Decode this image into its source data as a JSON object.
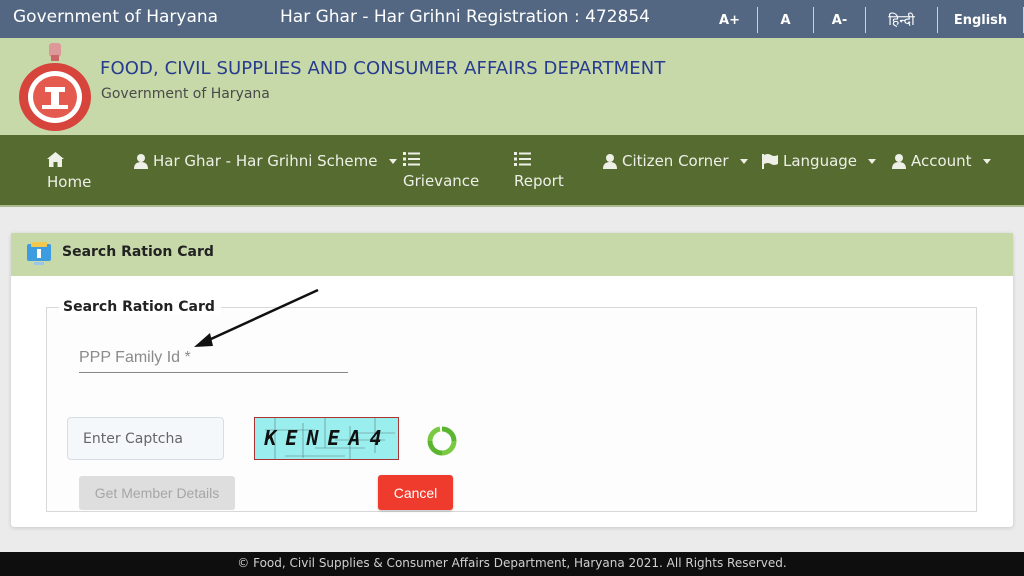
{
  "topbar": {
    "government": "Government of Haryana",
    "registration": "Har Ghar - Har Grihni Registration : 472854",
    "font_increase": "A+",
    "font_normal": "A",
    "font_decrease": "A-",
    "lang_hindi": "हिन्दी",
    "lang_english": "English"
  },
  "brand": {
    "department": "FOOD, CIVIL SUPPLIES AND CONSUMER AFFAIRS DEPARTMENT",
    "subtitle": "Government of Haryana",
    "emblem": "haryana-emblem-icon"
  },
  "nav": {
    "home": "Home",
    "scheme": "Har Ghar - Har Grihni Scheme",
    "grievance": "Grievance",
    "report": "Report",
    "citizen": "Citizen Corner",
    "language": "Language",
    "account": "Account"
  },
  "panel": {
    "title": "Search Ration Card",
    "legend": "Search Ration Card",
    "ppp_placeholder": "PPP Family Id *",
    "ppp_value": "",
    "captcha_placeholder": "Enter Captcha",
    "captcha_value": "",
    "captcha_text": "KENEA4",
    "get_details": "Get Member Details",
    "cancel": "Cancel"
  },
  "colors": {
    "topbar": "#536782",
    "brand_bg": "#c7d9a9",
    "nav_bg": "#556b2f",
    "cancel": "#ef3b2d",
    "dept_text": "#283c8e"
  },
  "footer": {
    "text": "© Food, Civil Supplies & Consumer Affairs Department, Haryana 2021. All Rights Reserved."
  }
}
